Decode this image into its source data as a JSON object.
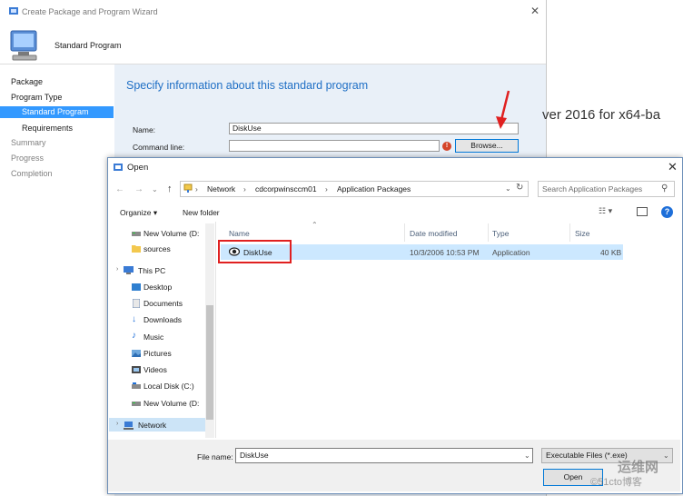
{
  "wizard": {
    "title": "Create Package and Program Wizard",
    "header": "Standard Program",
    "nav": [
      "Package",
      "Program Type",
      "Standard Program",
      "Requirements",
      "Summary",
      "Progress",
      "Completion"
    ],
    "heading": "Specify information about this standard program",
    "name_label": "Name:",
    "name_value": "DiskUse",
    "cmd_label": "Command line:",
    "cmd_value": "",
    "browse_label": "Browse...",
    "right_text": "ver 2016 for x64-ba"
  },
  "dialog": {
    "title": "Open",
    "breadcrumb": [
      "Network",
      "cdcorpwinsccm01",
      "Application Packages"
    ],
    "search_placeholder": "Search Application Packages",
    "organize_label": "Organize ▾",
    "new_folder_label": "New folder",
    "tree": [
      {
        "label": "New Volume (D:",
        "icon": "drive-icon"
      },
      {
        "label": "sources",
        "icon": "folder-icon"
      },
      {
        "label": "This PC",
        "icon": "pc-icon"
      },
      {
        "label": "Desktop",
        "icon": "desktop-icon"
      },
      {
        "label": "Documents",
        "icon": "documents-icon"
      },
      {
        "label": "Downloads",
        "icon": "downloads-icon"
      },
      {
        "label": "Music",
        "icon": "music-icon"
      },
      {
        "label": "Pictures",
        "icon": "pictures-icon"
      },
      {
        "label": "Videos",
        "icon": "videos-icon"
      },
      {
        "label": "Local Disk (C:)",
        "icon": "disk-icon"
      },
      {
        "label": "New Volume (D:",
        "icon": "drive-icon"
      },
      {
        "label": "Network",
        "icon": "network-icon"
      }
    ],
    "columns": [
      "Name",
      "Date modified",
      "Type",
      "Size"
    ],
    "files": [
      {
        "name": "DiskUse",
        "date": "10/3/2006 10:53 PM",
        "type": "Application",
        "size": "40 KB"
      }
    ],
    "file_name_label": "File name:",
    "file_name_value": "DiskUse",
    "file_type_value": "Executable Files (*.exe)",
    "open_label": "Open"
  },
  "watermark": {
    "line1": "运维网",
    "line2": "©51cto博客"
  }
}
